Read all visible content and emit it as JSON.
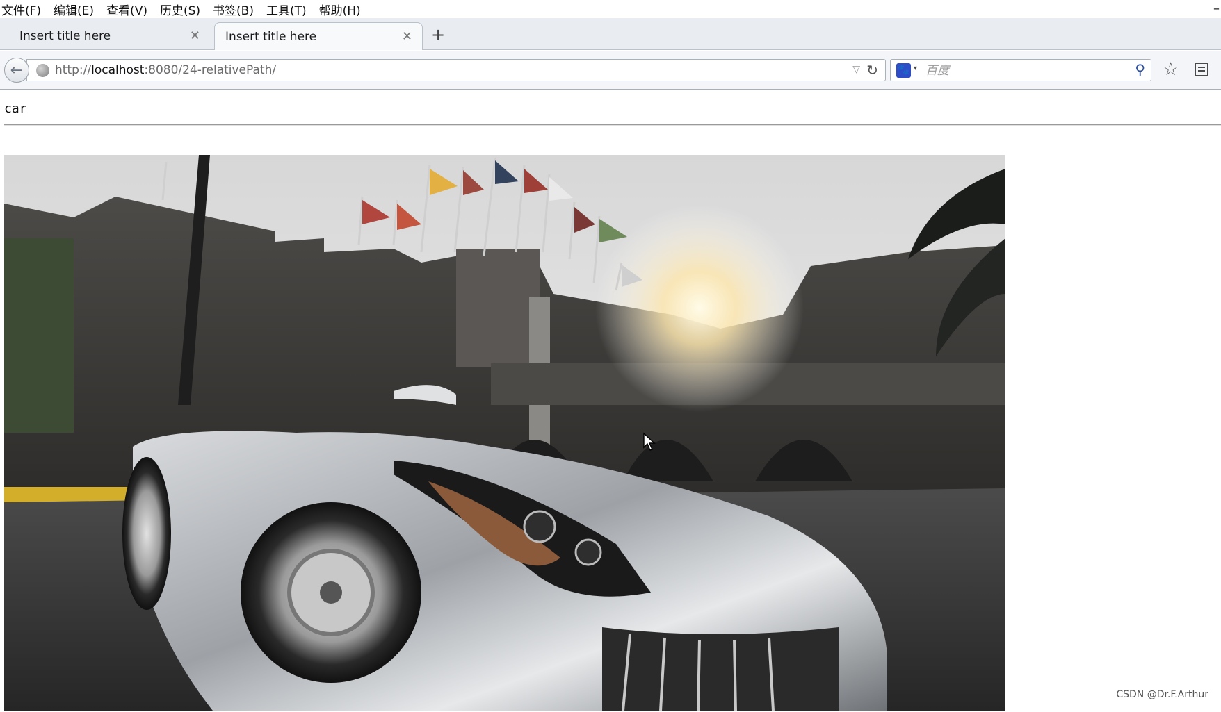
{
  "menubar": {
    "items": [
      "文件(F)",
      "编辑(E)",
      "查看(V)",
      "历史(S)",
      "书签(B)",
      "工具(T)",
      "帮助(H)"
    ],
    "minimize": "–"
  },
  "tabs": [
    {
      "title": "Insert title here",
      "active": false,
      "close": "✕"
    },
    {
      "title": "Insert title here",
      "active": true,
      "close": "✕"
    }
  ],
  "new_tab": "+",
  "navbar": {
    "back": "←",
    "url_prefix": "http://",
    "url_host": "localhost",
    "url_rest": ":8080/24-relativePath/",
    "dropdown": "▽",
    "reload": "↻"
  },
  "search": {
    "engine": "🐾",
    "engine_caret": "▾",
    "placeholder": "百度",
    "go": "⚲"
  },
  "toolbar_icons": {
    "star": "☆"
  },
  "page": {
    "heading": "car",
    "image_subject": "silver sports car in front of stone fortress with flags"
  },
  "watermark": "CSDN @Dr.F.Arthur",
  "colors": {
    "tabstrip": "#e9edf2",
    "navbar": "#f3f5f8",
    "engine": "#2d4ec8"
  }
}
